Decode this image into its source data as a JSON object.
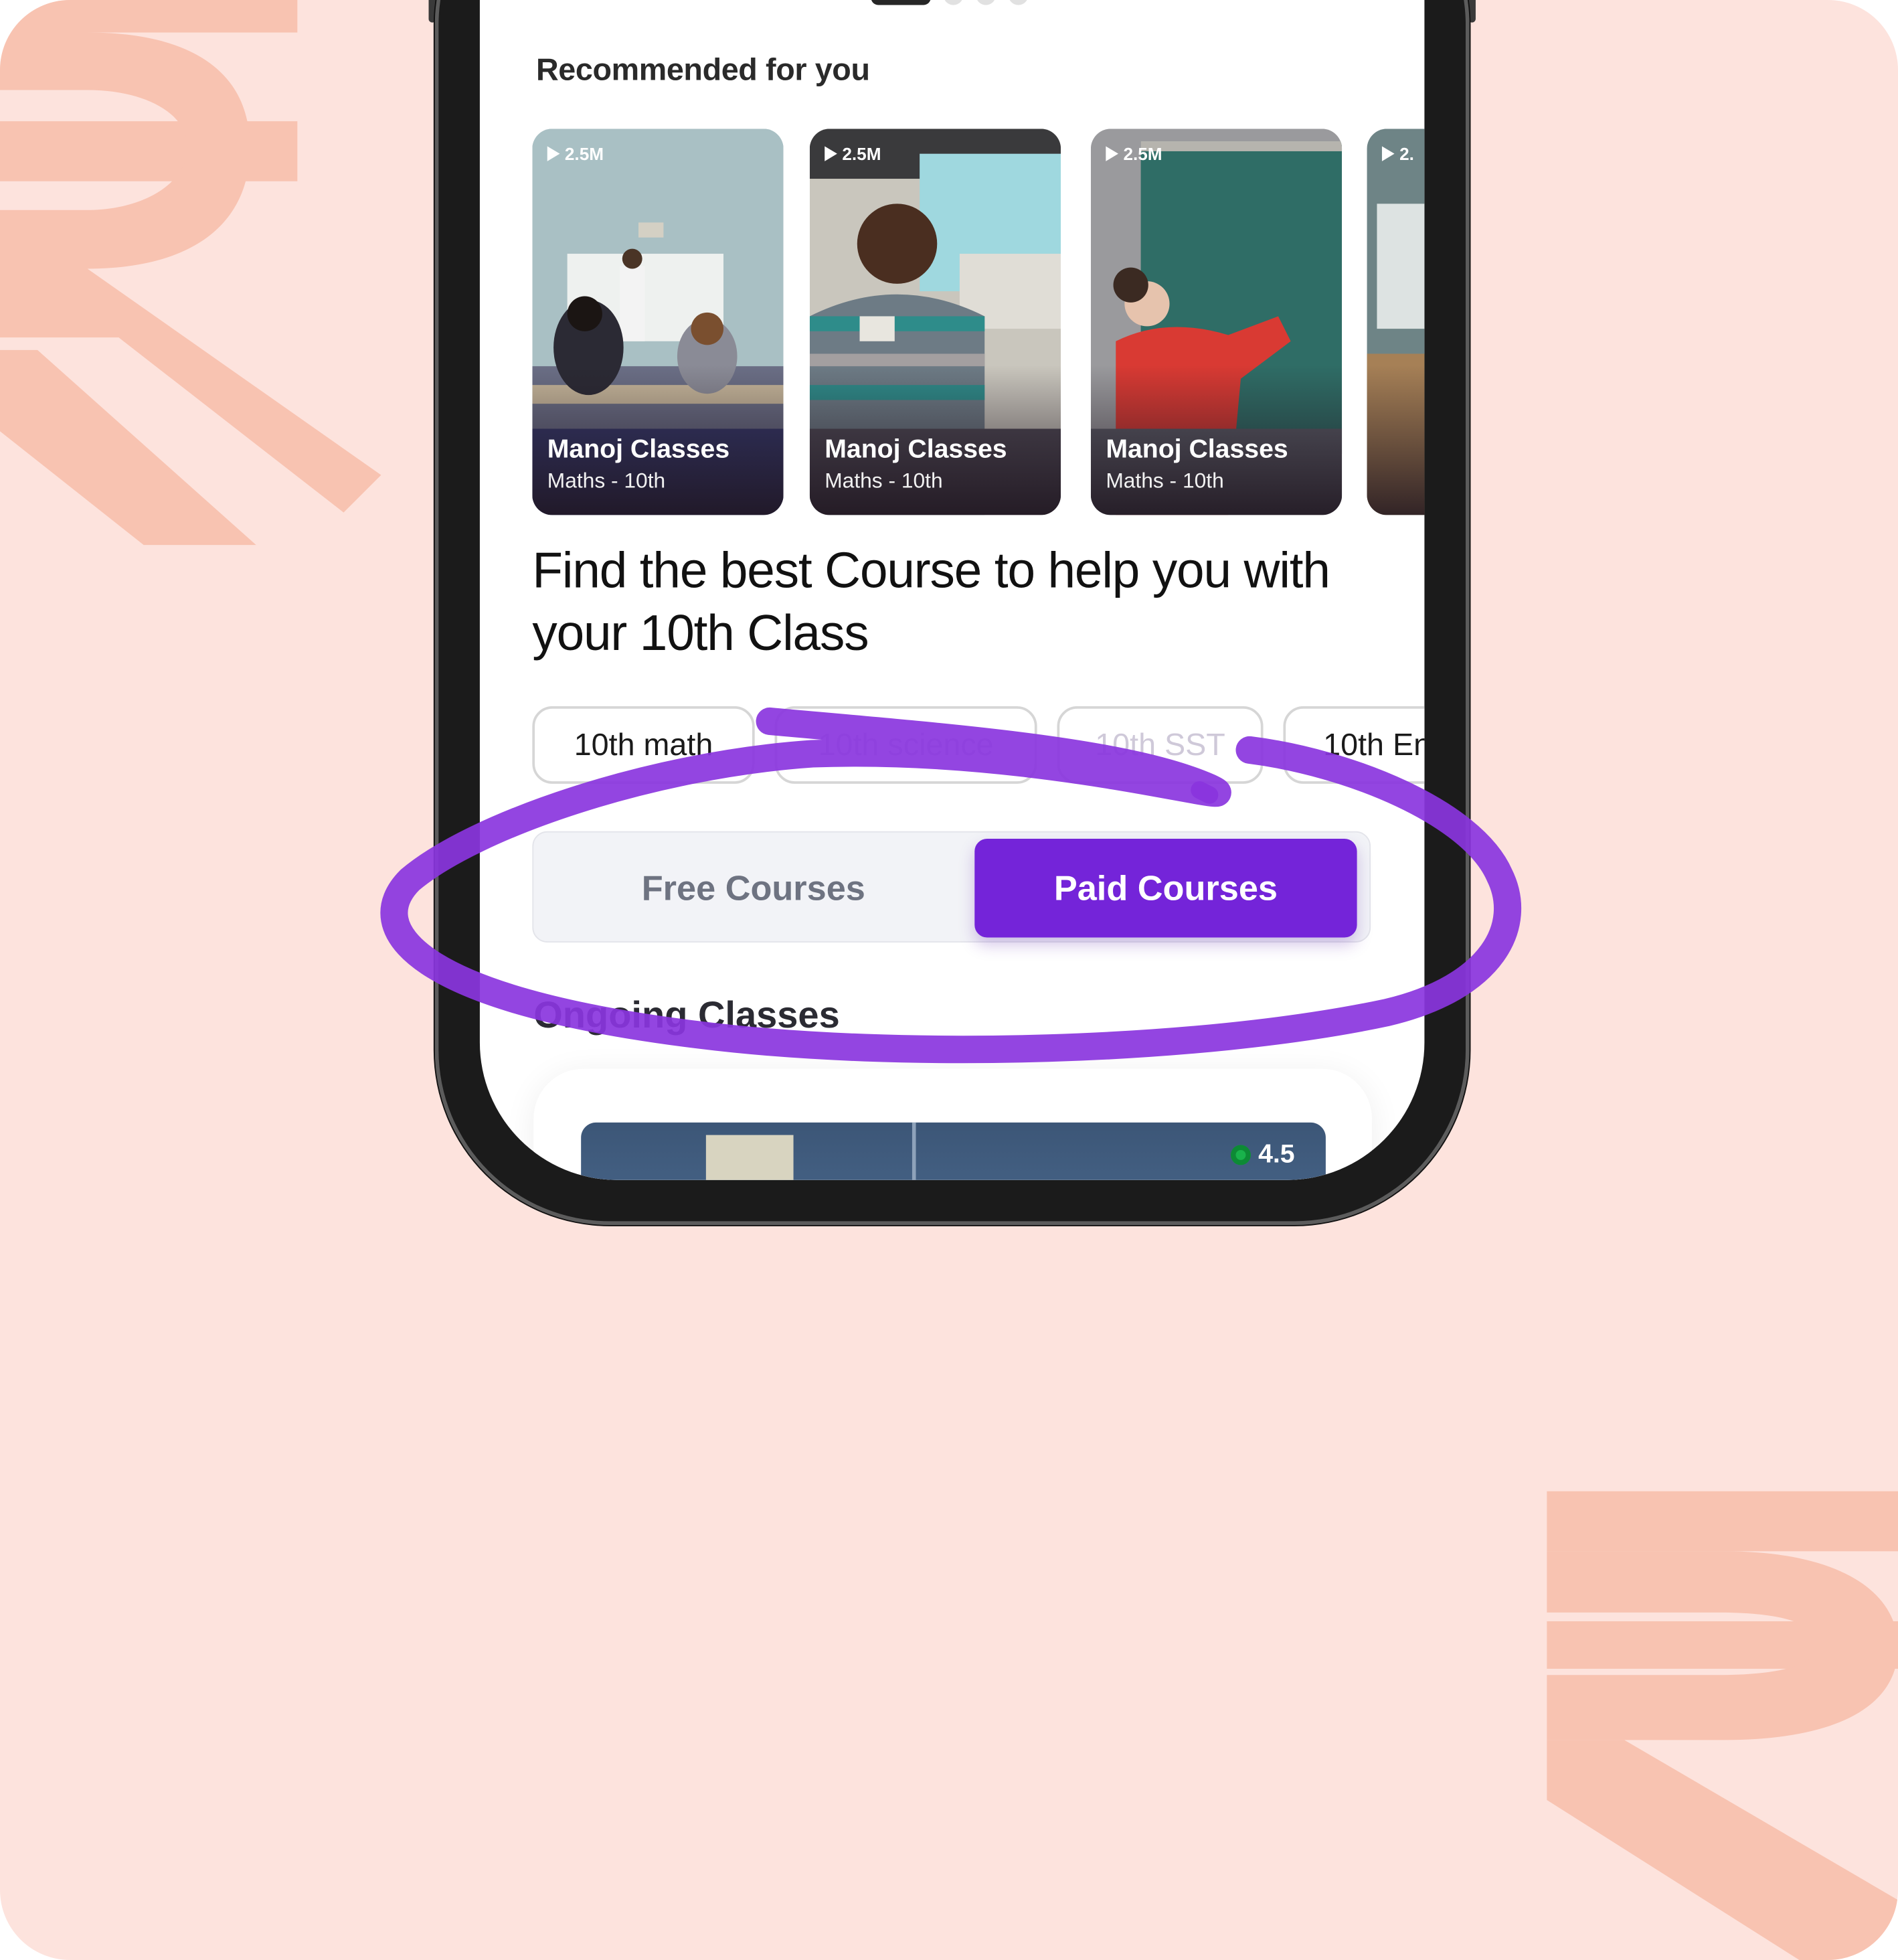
{
  "colors": {
    "background": "#fde3dd",
    "decoration": "#f8c3b1",
    "accent": "#7424d9",
    "annotation": "#8a35de",
    "rating_dot": "#19b24b"
  },
  "icons": {
    "background_symbol": "rupee-icon",
    "views": "play-icon",
    "rating": "rating-dot-icon"
  },
  "recommended": {
    "title": "Recommended for you",
    "cards": [
      {
        "views": "2.5M",
        "name": "Manoj Classes",
        "subtitle": "Maths - 10th"
      },
      {
        "views": "2.5M",
        "name": "Manoj Classes",
        "subtitle": "Maths - 10th"
      },
      {
        "views": "2.5M",
        "name": "Manoj Classes",
        "subtitle": "Maths - 10th"
      },
      {
        "views": "2.",
        "name": "",
        "subtitle": ""
      }
    ]
  },
  "headline": "Find the best Course to help you with your 10th Class",
  "chips": [
    "10th math",
    "10th science",
    "10th SST",
    "10th En"
  ],
  "toggle": {
    "free_label": "Free Courses",
    "paid_label": "Paid Courses",
    "selected": "Paid Courses"
  },
  "ongoing": {
    "title": "Ongoing Classes",
    "rating": "4.5"
  }
}
